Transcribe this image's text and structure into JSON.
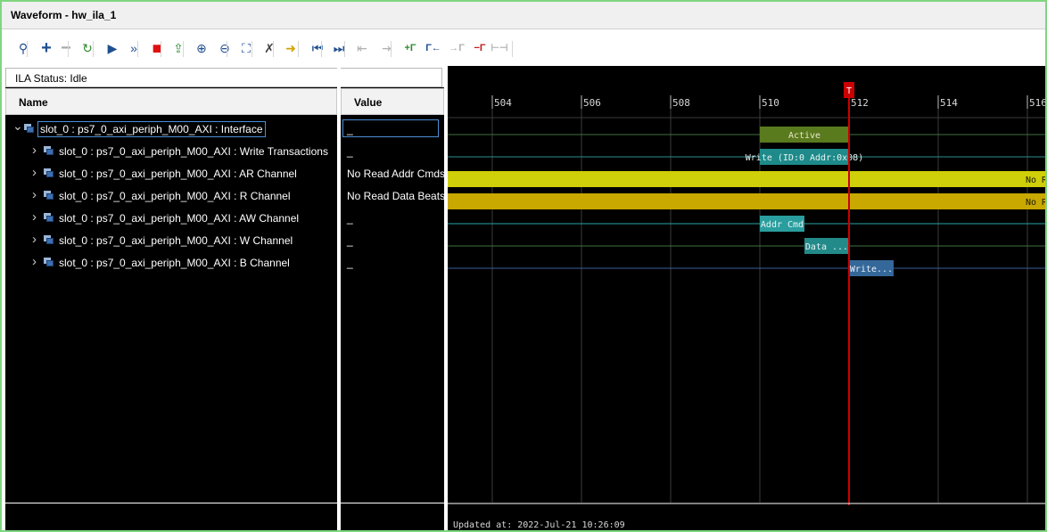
{
  "window": {
    "title": "Waveform - hw_ila_1"
  },
  "toolbar": {
    "buttons": [
      {
        "name": "search-icon",
        "glyph": "⚲",
        "color": "#1f4f8f"
      },
      {
        "name": "add-icon",
        "glyph": "+",
        "color": "#1f4f8f"
      },
      {
        "name": "remove-icon",
        "glyph": "−",
        "color": "#a8a8a8"
      },
      {
        "name": "run-trigger-immediate-icon",
        "glyph": "↻",
        "color": "#2e8b2e"
      },
      {
        "name": "run-trigger-icon",
        "glyph": "▶",
        "color": "#1f4f8f"
      },
      {
        "name": "run-trigger-continuous-icon",
        "glyph": "»",
        "color": "#1f4f8f"
      },
      {
        "name": "stop-trigger-icon",
        "glyph": "■",
        "color": "#e01010"
      },
      {
        "name": "export-icon",
        "glyph": "⇪",
        "color": "#2e8b2e"
      },
      {
        "name": "zoom-in-icon",
        "glyph": "⊕",
        "color": "#1f4f8f"
      },
      {
        "name": "zoom-out-icon",
        "glyph": "⊖",
        "color": "#1f4f8f"
      },
      {
        "name": "zoom-fit-icon",
        "glyph": "⛶",
        "color": "#1f4f8f"
      },
      {
        "name": "marker-cursor-icon",
        "glyph": "✗",
        "color": "#404040"
      },
      {
        "name": "go-to-cursor-icon",
        "glyph": "➜",
        "color": "#d4a000"
      },
      {
        "name": "go-to-start-icon",
        "glyph": "⏮",
        "color": "#1f4f8f"
      },
      {
        "name": "go-to-end-icon",
        "glyph": "⏭",
        "color": "#1f4f8f"
      },
      {
        "name": "previous-transition-icon",
        "glyph": "⇤",
        "color": "#b0b0b0"
      },
      {
        "name": "next-transition-icon",
        "glyph": "⇥",
        "color": "#b0b0b0"
      },
      {
        "name": "add-marker-icon",
        "glyph": "+Γ",
        "color": "#2e8b2e"
      },
      {
        "name": "previous-marker-icon",
        "glyph": "Γ←",
        "color": "#1f4f8f"
      },
      {
        "name": "next-marker-icon",
        "glyph": "→Γ",
        "color": "#b0b0b0"
      },
      {
        "name": "remove-marker-icon",
        "glyph": "−Γ",
        "color": "#c01818"
      },
      {
        "name": "swap-cursors-icon",
        "glyph": "⊢⊣",
        "color": "#b0b0b0"
      }
    ]
  },
  "ila_status": {
    "text": "ILA Status: Idle"
  },
  "columns": {
    "name": "Name",
    "value": "Value"
  },
  "rows": [
    {
      "label": "slot_0 : ps7_0_axi_periph_M00_AXI : Interface",
      "value": "_",
      "expanded": true
    },
    {
      "label": "slot_0 : ps7_0_axi_periph_M00_AXI : Write Transactions",
      "value": "_",
      "expanded": false
    },
    {
      "label": "slot_0 : ps7_0_axi_periph_M00_AXI : AR Channel",
      "value": "No Read Addr Cmds",
      "expanded": false
    },
    {
      "label": "slot_0 : ps7_0_axi_periph_M00_AXI : R Channel",
      "value": "No Read Data Beats",
      "expanded": false
    },
    {
      "label": "slot_0 : ps7_0_axi_periph_M00_AXI : AW Channel",
      "value": "_",
      "expanded": false
    },
    {
      "label": "slot_0 : ps7_0_axi_periph_M00_AXI : W Channel",
      "value": "_",
      "expanded": false
    },
    {
      "label": "slot_0 : ps7_0_axi_periph_M00_AXI : B Channel",
      "value": "_",
      "expanded": false
    }
  ],
  "waveform": {
    "visible_start": 503,
    "visible_end": 516.4,
    "ticks": [
      504,
      506,
      508,
      510,
      512,
      514,
      516
    ],
    "trigger": {
      "label": "T",
      "position": 512,
      "color": "#cc0000"
    },
    "signals": [
      {
        "line_color": "#3f6f3f",
        "segments": [
          {
            "start": 510,
            "end": 512,
            "text": "Active",
            "color": "#5a7a1e",
            "text_color": "#e8e8c8"
          }
        ]
      },
      {
        "line_color": "#2a8f8a",
        "segments": [
          {
            "start": 510,
            "end": 512,
            "text": "Write (ID:0 Addr:0x08)",
            "color": "#1e8a8a",
            "text_color": "#e8f4f4"
          }
        ]
      },
      {
        "line_color": "#c8c800",
        "segments": [
          {
            "start": 503,
            "end": 516.4,
            "text": "No R",
            "color": "#cfcf0a",
            "text_color": "#1a1a00"
          }
        ]
      },
      {
        "line_color": "#c8a800",
        "segments": [
          {
            "start": 503,
            "end": 516.4,
            "text": "No R",
            "color": "#c9a800",
            "text_color": "#1a1a00"
          }
        ]
      },
      {
        "line_color": "#2aa3a3",
        "segments": [
          {
            "start": 510,
            "end": 511,
            "text": "Addr Cmd",
            "color": "#2a9e9e",
            "text_color": "#e8f4f4"
          }
        ]
      },
      {
        "line_color": "#3f6f3f",
        "segments": [
          {
            "start": 511,
            "end": 512,
            "text": "Data ...",
            "color": "#238a8a",
            "text_color": "#e8f4f4"
          }
        ]
      },
      {
        "line_color": "#3a5f9a",
        "segments": [
          {
            "start": 512,
            "end": 513,
            "text": "Write...",
            "color": "#35689a",
            "text_color": "#e8f0f8"
          }
        ]
      }
    ]
  },
  "footer": {
    "updated_text": "Updated at:  2022-Jul-21 10:26:09"
  }
}
